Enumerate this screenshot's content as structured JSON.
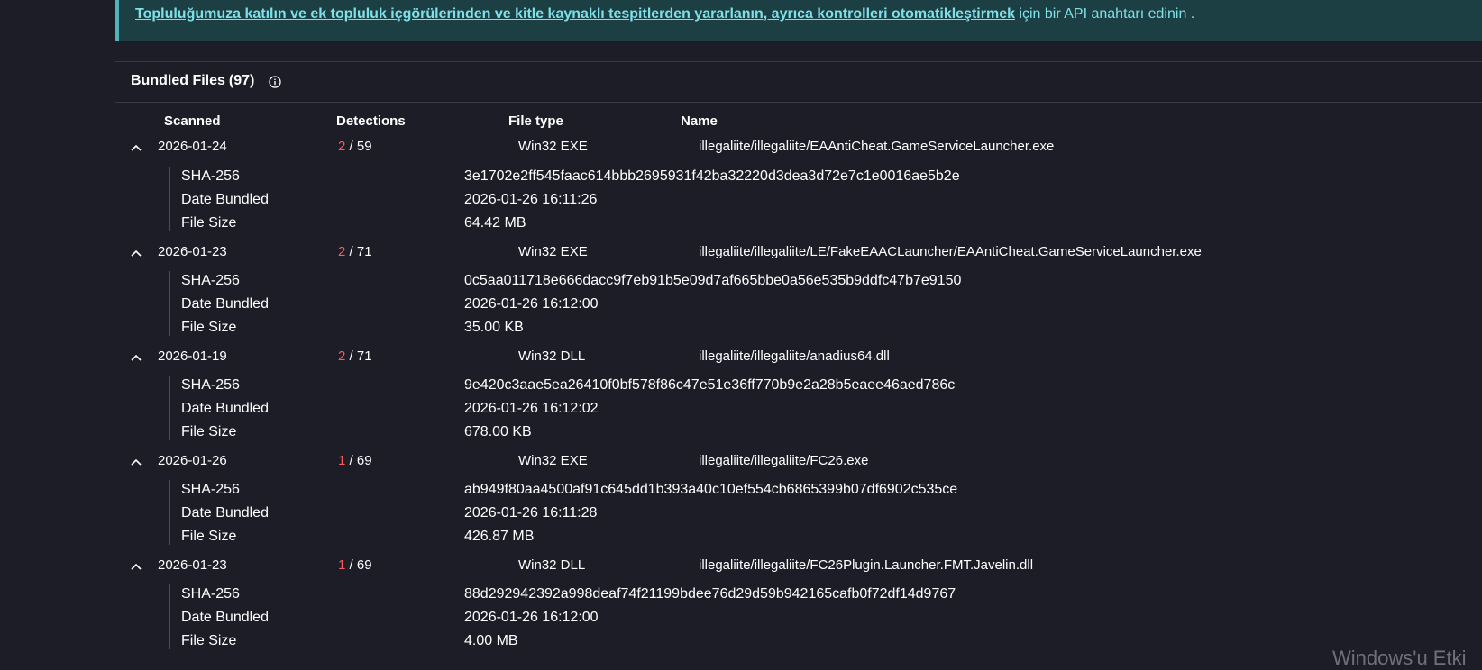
{
  "banner": {
    "link_text": "Topluluğumuza katılın ve ek topluluk içgörülerinden ve kitle kaynaklı tespitlerden yararlanın, ayrıca kontrolleri otomatikleştirmek",
    "suffix_text": " için bir API anahtarı edinin ."
  },
  "section": {
    "title": "Bundled Files",
    "count": "(97)",
    "icon": "info-icon"
  },
  "columns": {
    "scanned": "Scanned",
    "detections": "Detections",
    "file_type": "File type",
    "name": "Name"
  },
  "detail_labels": {
    "sha": "SHA-256",
    "date": "Date Bundled",
    "size": "File Size"
  },
  "files": [
    {
      "scanned": "2026-01-24",
      "det_count": "2",
      "det_total": " / 59",
      "file_type": "Win32 EXE",
      "name": "illegaliite/illegaliite/EAAntiCheat.GameServiceLauncher.exe",
      "sha256": "3e1702e2ff545faac614bbb2695931f42ba32220d3dea3d72e7c1e0016ae5b2e",
      "date_bundled": "2026-01-26 16:11:26",
      "file_size": "64.42 MB"
    },
    {
      "scanned": "2026-01-23",
      "det_count": "2",
      "det_total": " / 71",
      "file_type": "Win32 EXE",
      "name": "illegaliite/illegaliite/LE/FakeEAACLauncher/EAAntiCheat.GameServiceLauncher.exe",
      "sha256": "0c5aa011718e666dacc9f7eb91b5e09d7af665bbe0a56e535b9ddfc47b7e9150",
      "date_bundled": "2026-01-26 16:12:00",
      "file_size": "35.00 KB"
    },
    {
      "scanned": "2026-01-19",
      "det_count": "2",
      "det_total": " / 71",
      "file_type": "Win32 DLL",
      "name": "illegaliite/illegaliite/anadius64.dll",
      "sha256": "9e420c3aae5ea26410f0bf578f86c47e51e36ff770b9e2a28b5eaee46aed786c",
      "date_bundled": "2026-01-26 16:12:02",
      "file_size": "678.00 KB"
    },
    {
      "scanned": "2026-01-26",
      "det_count": "1",
      "det_total": " / 69",
      "file_type": "Win32 EXE",
      "name": "illegaliite/illegaliite/FC26.exe",
      "sha256": "ab949f80aa4500af91c645dd1b393a40c10ef554cb6865399b07df6902c535ce",
      "date_bundled": "2026-01-26 16:11:28",
      "file_size": "426.87 MB"
    },
    {
      "scanned": "2026-01-23",
      "det_count": "1",
      "det_total": " / 69",
      "file_type": "Win32 DLL",
      "name": "illegaliite/illegaliite/FC26Plugin.Launcher.FMT.Javelin.dll",
      "sha256": "88d292942392a998deaf74f21199bdee76d29d59b942165cafb0f72df14d9767",
      "date_bundled": "2026-01-26 16:12:00",
      "file_size": "4.00 MB"
    }
  ],
  "watermark": "Windows'u Etki",
  "colors": {
    "background": "#1c1d27",
    "banner_bg": "#1c3f44",
    "banner_text": "#7fe0e8",
    "detection_red": "#ff5a5a"
  }
}
